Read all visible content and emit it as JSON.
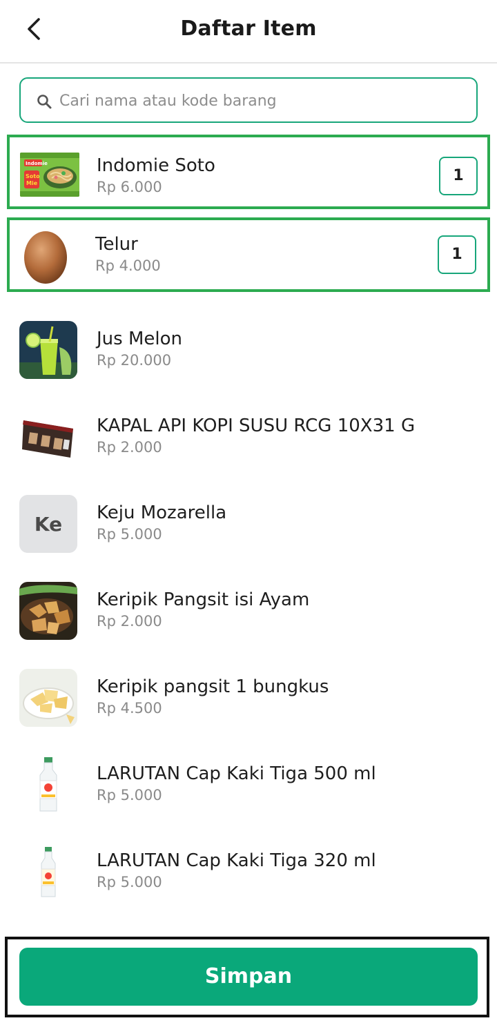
{
  "header": {
    "title": "Daftar Item"
  },
  "search": {
    "placeholder": "Cari nama atau kode barang"
  },
  "items": [
    {
      "name": "Indomie Soto",
      "price": "Rp 6.000",
      "qty": "1",
      "selected": true
    },
    {
      "name": "Telur",
      "price": "Rp 4.000",
      "qty": "1",
      "selected": true
    },
    {
      "name": "Jus Melon",
      "price": "Rp 20.000"
    },
    {
      "name": "KAPAL API KOPI SUSU RCG 10X31 G",
      "price": "Rp 2.000"
    },
    {
      "name": "Keju Mozarella",
      "price": "Rp 5.000",
      "initials": "Ke"
    },
    {
      "name": "Keripik Pangsit isi Ayam",
      "price": "Rp 2.000"
    },
    {
      "name": "Keripik pangsit 1 bungkus",
      "price": "Rp 4.500"
    },
    {
      "name": "LARUTAN Cap Kaki Tiga 500 ml",
      "price": "Rp 5.000"
    },
    {
      "name": "LARUTAN Cap Kaki Tiga 320 ml",
      "price": "Rp 5.000"
    }
  ],
  "footer": {
    "save_label": "Simpan"
  },
  "colors": {
    "accent": "#0aa87a",
    "selected_border": "#2cab50"
  }
}
